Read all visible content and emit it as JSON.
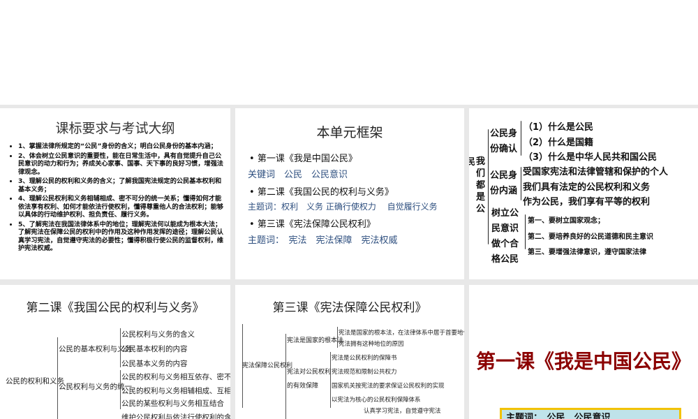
{
  "slide1": {
    "title": "课标要求与考试大纲",
    "items": [
      "1、掌握法律所规定的“公民”身份的含义；明白公民身份的基本内涵；",
      "2、体会树立公民意识的重要性，能在日常生活中，具有自觉提升自己公民意识的动力和行为；养成关心家事、国事、天下事的良好习惯，增强法律观念。",
      "3、理解公民的权利和义务的含义；了解我国宪法规定的公民基本权利和基本义务；",
      "4、理解公民权利和义务相辅相成、密不可分的统一关系；懂得如何才能依法享有权利、如何才能依法行使权利，懂得尊重他人的合法权利；能够以具体的行动维护权利、担负责任、履行义务。",
      "5、了解宪法在我国法律体系中的地位；理解宪法何以能成为根本大法；了解宪法在保障公民的权利中的作用及这种作用发挥的途径；理解公民认真学习宪法，自觉遵守宪法的必要性；懂得积极行使公民的监督权利，维护宪法权威。"
    ]
  },
  "slide2": {
    "title": "本单元框架",
    "l1": "第一课《我是中国公民》",
    "k1": "关键词　公民　公民意识",
    "l2": "第二课《我国公民的权利与义务》",
    "k2": "主题词：权利　义务 正确行使权力　 自觉履行义务",
    "l3": "第三课《宪法保障公民权利》",
    "k3": "主题词：　宪法　宪法保障　宪法权威"
  },
  "slide3": {
    "edge": "民",
    "root": "我们都是公",
    "b1": "公民身份确认",
    "b1i": [
      "（1）什么是公民",
      "（2）什么是国籍",
      "（3）什么是中华人民共和国公民"
    ],
    "b2": "公民身份内涵",
    "b2i": [
      "受国家宪法和法律管辖和保护的个人",
      "我们具有法定的公民权利和义务",
      "作为公民，我们享有平等的权利"
    ],
    "b3": "树立公民意识做个合格公民",
    "b3i": [
      "第一、要树立国家观念；",
      "第二、要培养良好的公民道德和民主意识",
      "第三、要增强法律意识，遵守国家法律"
    ]
  },
  "slide4": {
    "title": "第二课《我国公民的权利与义务》",
    "root": "公民的权利和义务",
    "n1": "公民的基本权利与义务",
    "n1i": [
      "公民权利与义务的含义",
      "公民基本权利的内容",
      "公民基本义务的内容"
    ],
    "n2": "公民权利与义务的统一",
    "n2i": [
      "公民的权利与义务相互依存、密不可分",
      "公民的权利与义务相辅相成、互相促进",
      "公民的某些权利与义务相互结合"
    ],
    "n3i": "维护公民权利与依法行使权利的含义"
  },
  "slide5": {
    "title": "第三课《宪法保障公民权利》",
    "root": "宪法保障公民权利",
    "n1": "宪法是国家的根本法",
    "n1i": [
      "宪法是国家的根本法，在法律体系中居于首要地位",
      "宪法拥有这种地位的原因"
    ],
    "n2": "宪法对公民权利的有效保障",
    "n2i": [
      "宪法是公民权利的保障书",
      "宪法规范和限制公共权力",
      "国家机关按宪法的要求保证公民权利的实现",
      "以宪法为核心的公民权利保障体系"
    ],
    "n3i": "认真学习宪法，自觉遵守宪法"
  },
  "slide6": {
    "title": "第一课《我是中国公民》",
    "box": "主题词：　公民　公民意识"
  }
}
